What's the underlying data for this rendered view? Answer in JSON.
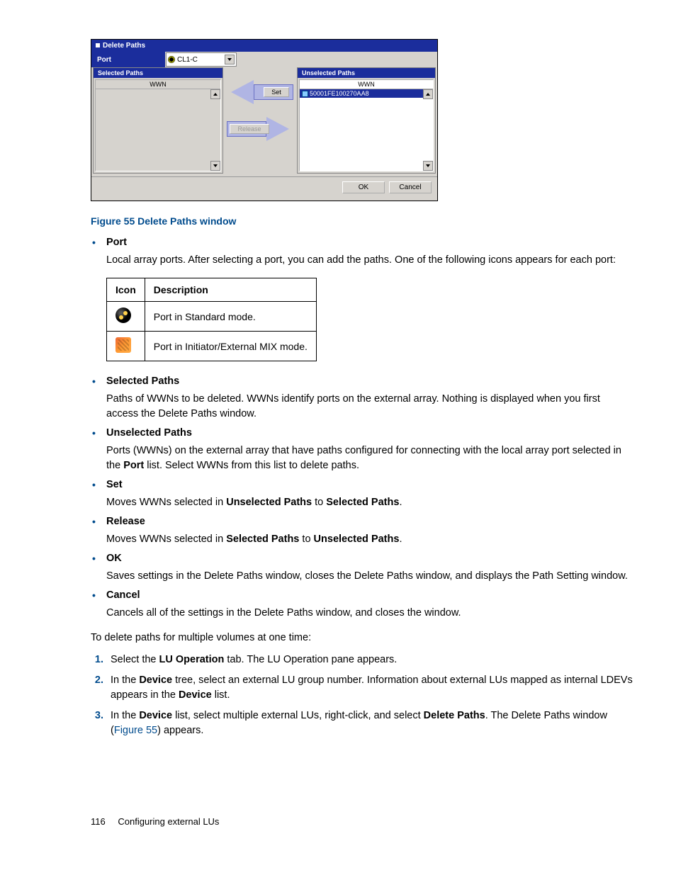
{
  "window": {
    "title": "Delete Paths",
    "port_label": "Port",
    "port_value": "CL1-C",
    "selected_header": "Selected Paths",
    "unselected_header": "Unselected Paths",
    "col_wwn": "WWN",
    "unselected_row": "50001FE100270AA8",
    "btn_set": "Set",
    "btn_release": "Release",
    "btn_ok": "OK",
    "btn_cancel": "Cancel"
  },
  "fig_caption": "Figure 55 Delete Paths window",
  "bullets": {
    "port": {
      "term": "Port",
      "desc": "Local array ports. After selecting a port, you can add the paths. One of the following icons appears for each port:"
    },
    "sel": {
      "term": "Selected Paths",
      "desc": "Paths of WWNs to be deleted. WWNs identify ports on the external array. Nothing is displayed when you first access the Delete Paths window."
    },
    "unsel": {
      "term": "Unselected Paths",
      "desc_pre": "Ports (WWNs) on the external array that have paths configured for connecting with the local array port selected in the ",
      "desc_port": "Port",
      "desc_post": " list. Select WWNs from this list to delete paths."
    },
    "set": {
      "term": "Set",
      "pre": "Moves WWNs selected in ",
      "a": "Unselected Paths",
      "mid": " to ",
      "b": "Selected Paths",
      "post": "."
    },
    "rel": {
      "term": "Release",
      "pre": "Moves WWNs selected in ",
      "a": "Selected Paths",
      "mid": " to ",
      "b": "Unselected Paths",
      "post": "."
    },
    "ok": {
      "term": "OK",
      "desc": "Saves settings in the Delete Paths window, closes the Delete Paths window, and displays the Path Setting window."
    },
    "cancel": {
      "term": "Cancel",
      "desc": "Cancels all of the settings in the Delete Paths window, and closes the window."
    }
  },
  "icon_table": {
    "h_icon": "Icon",
    "h_desc": "Description",
    "r1": "Port in Standard mode.",
    "r2": "Port in Initiator/External MIX mode."
  },
  "lead": "To delete paths for multiple volumes at one time:",
  "steps": {
    "s1_pre": "Select the ",
    "s1_b": "LU Operation",
    "s1_post": " tab. The LU Operation pane appears.",
    "s2_pre": "In the ",
    "s2_b1": "Device",
    "s2_mid": " tree, select an external LU group number. Information about external LUs mapped as internal LDEVs appears in the ",
    "s2_b2": "Device",
    "s2_post": " list.",
    "s3_pre": "In the ",
    "s3_b1": "Device",
    "s3_mid": " list, select multiple external LUs, right-click, and select ",
    "s3_b2": "Delete Paths",
    "s3_post1": ". The Delete Paths window (",
    "s3_link": "Figure 55",
    "s3_post2": ") appears."
  },
  "footer": {
    "page": "116",
    "section": "Configuring external LUs"
  }
}
